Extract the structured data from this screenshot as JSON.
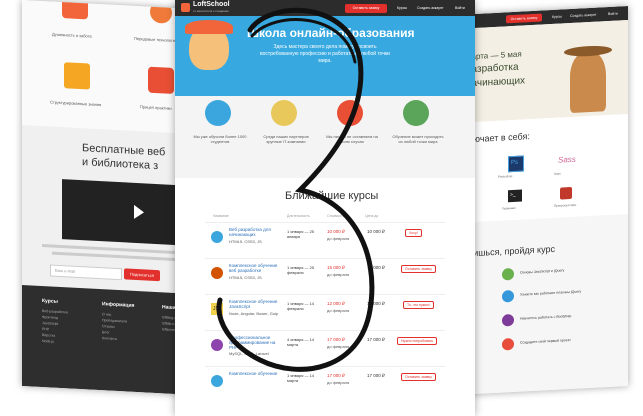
{
  "left_page": {
    "features": [
      "Душевность и забота",
      "Передовые технологии",
      "Структурированные знания",
      "Прицел практики"
    ],
    "section_title": "Бесплатные веб",
    "section_title2": "и библиотека з",
    "email_placeholder": "Ваш e-mail",
    "subscribe_label": "Подписаться",
    "footer_col1": "Курсы",
    "footer_col2": "Информация",
    "footer_col3": "Наши проекты",
    "footer_items1": [
      "Веб-разработка",
      "Фронтенд",
      "JavaScript",
      "PHP",
      "Вёрстка",
      "Node.js"
    ],
    "footer_items2": [
      "О нас",
      "Преподаватели",
      "Отзывы",
      "Блог",
      "Контакты"
    ],
    "footer_items3": [
      "loftblog.ru",
      "loftlab.ru",
      "loftscreen.ru"
    ]
  },
  "center_page": {
    "logo": "LoftSchool",
    "logo_sub": "от мыслителя к созданию",
    "nav_cta": "Оставить заявку",
    "nav_courses": "Курсы",
    "nav_create": "Создать аккаунт",
    "nav_login": "Войти",
    "hero_title": "Школа онлайн-образования",
    "hero_text": "Здесь мастера своего дела помогут освоить востребованную профессию и работать из любой точки мира.",
    "feature_texts": [
      "Мы уже обучили более 1000 студентов",
      "Среди наших партнеров крупные IT-компании",
      "Мы ничего не оставляем на волю случая",
      "Обучение может проходить из любой точки мира"
    ],
    "courses_title": "Ближайшие курсы",
    "table_headers": [
      "Название",
      "Длительность",
      "Стоимость",
      "Цена до"
    ],
    "courses": [
      {
        "name": "Веб разработка для начинающих",
        "sub": "HTML5, CSS3, JS",
        "dates": "1 января — 25 января",
        "price": "10 000 ₽",
        "old": "до февраля",
        "btn": "Хочу!"
      },
      {
        "name": "Комплексное обучение веб разработке",
        "sub": "HTML5, CSS3, JS",
        "dates": "1 января — 25 февраля",
        "price": "15 000 ₽",
        "old": "до февраля",
        "btn": "Оставить заявку"
      },
      {
        "name": "Комплексное обучение JavaScript",
        "sub": "Node, Angular, Bower, Gulp",
        "dates": "1 января — 14 февраля",
        "price": "12 000 ₽",
        "old": "до февраля",
        "btn": "То, что нужно!"
      },
      {
        "name": "Профессиональное программирование на PHP",
        "sub": "MySQL, MVC, Laravel",
        "dates": "4 января — 14 марта",
        "price": "17 000 ₽",
        "old": "до февраля",
        "btn": "Нужно попробовать"
      },
      {
        "name": "Комплексное обучение",
        "sub": "",
        "dates": "1 января — 14 марта",
        "price": "17 000 ₽",
        "old": "до февраля",
        "btn": "Оставить заявку"
      }
    ]
  },
  "right_page": {
    "nav_cta": "Оставить заявку",
    "nav_courses": "Курсы",
    "nav_create": "Создать аккаунт",
    "nav_login": "Войти",
    "hero_dates": "марта — 5 мая",
    "hero_title1": "разработка",
    "hero_title2": "начинающих",
    "includes_title": "ключает в себя:",
    "tool_labels": [
      "Photoshop",
      "Sass",
      "Терминал",
      "Препроцессоры"
    ],
    "learn_title": "учишься, пройдя курс",
    "learn_items": [
      "Основы JavaScript и jQuery",
      "Узнаете как работают плагины jQuery",
      "Научитесь работать с Bootstrap",
      "Создадите свой первый проект"
    ]
  },
  "overlay_glyph": "3"
}
